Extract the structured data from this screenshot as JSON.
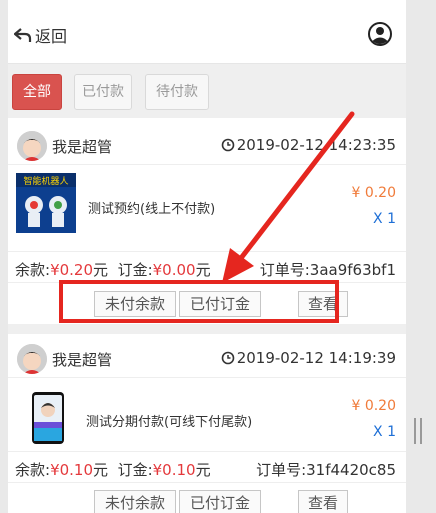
{
  "header": {
    "back_label": "返回"
  },
  "tabs": [
    {
      "label": "全部",
      "active": true
    },
    {
      "label": "已付款",
      "active": false
    },
    {
      "label": "待付款",
      "active": false
    }
  ],
  "orders": [
    {
      "user": "我是超管",
      "time": "2019-02-12 14:23:35",
      "product_name": "测试预约(线上不付款)",
      "price": "¥ 0.20",
      "qty": "X 1",
      "balance_label": "余款:",
      "balance_value": "¥0.20",
      "balance_unit": "元",
      "deposit_label": "订金:",
      "deposit_value": "¥0.00",
      "deposit_unit": "元",
      "order_no": "订单号:3aa9f63bf1",
      "buttons": [
        "未付余款",
        "已付订金",
        "查看"
      ]
    },
    {
      "user": "我是超管",
      "time": "2019-02-12 14:19:39",
      "product_name": "测试分期付款(可线下付尾款)",
      "price": "¥ 0.20",
      "qty": "X 1",
      "balance_label": "余款:",
      "balance_value": "¥0.10",
      "balance_unit": "元",
      "deposit_label": "订金:",
      "deposit_value": "¥0.10",
      "deposit_unit": "元",
      "order_no": "订单号:31f4420c85",
      "buttons": [
        "未付余款",
        "已付订金",
        "查看"
      ]
    }
  ],
  "colors": {
    "accent": "#d9534f",
    "price": "#f07b3a",
    "qty": "#1e6fd6",
    "annotation": "#e5261f"
  },
  "product1_image_text": "智能机器人"
}
